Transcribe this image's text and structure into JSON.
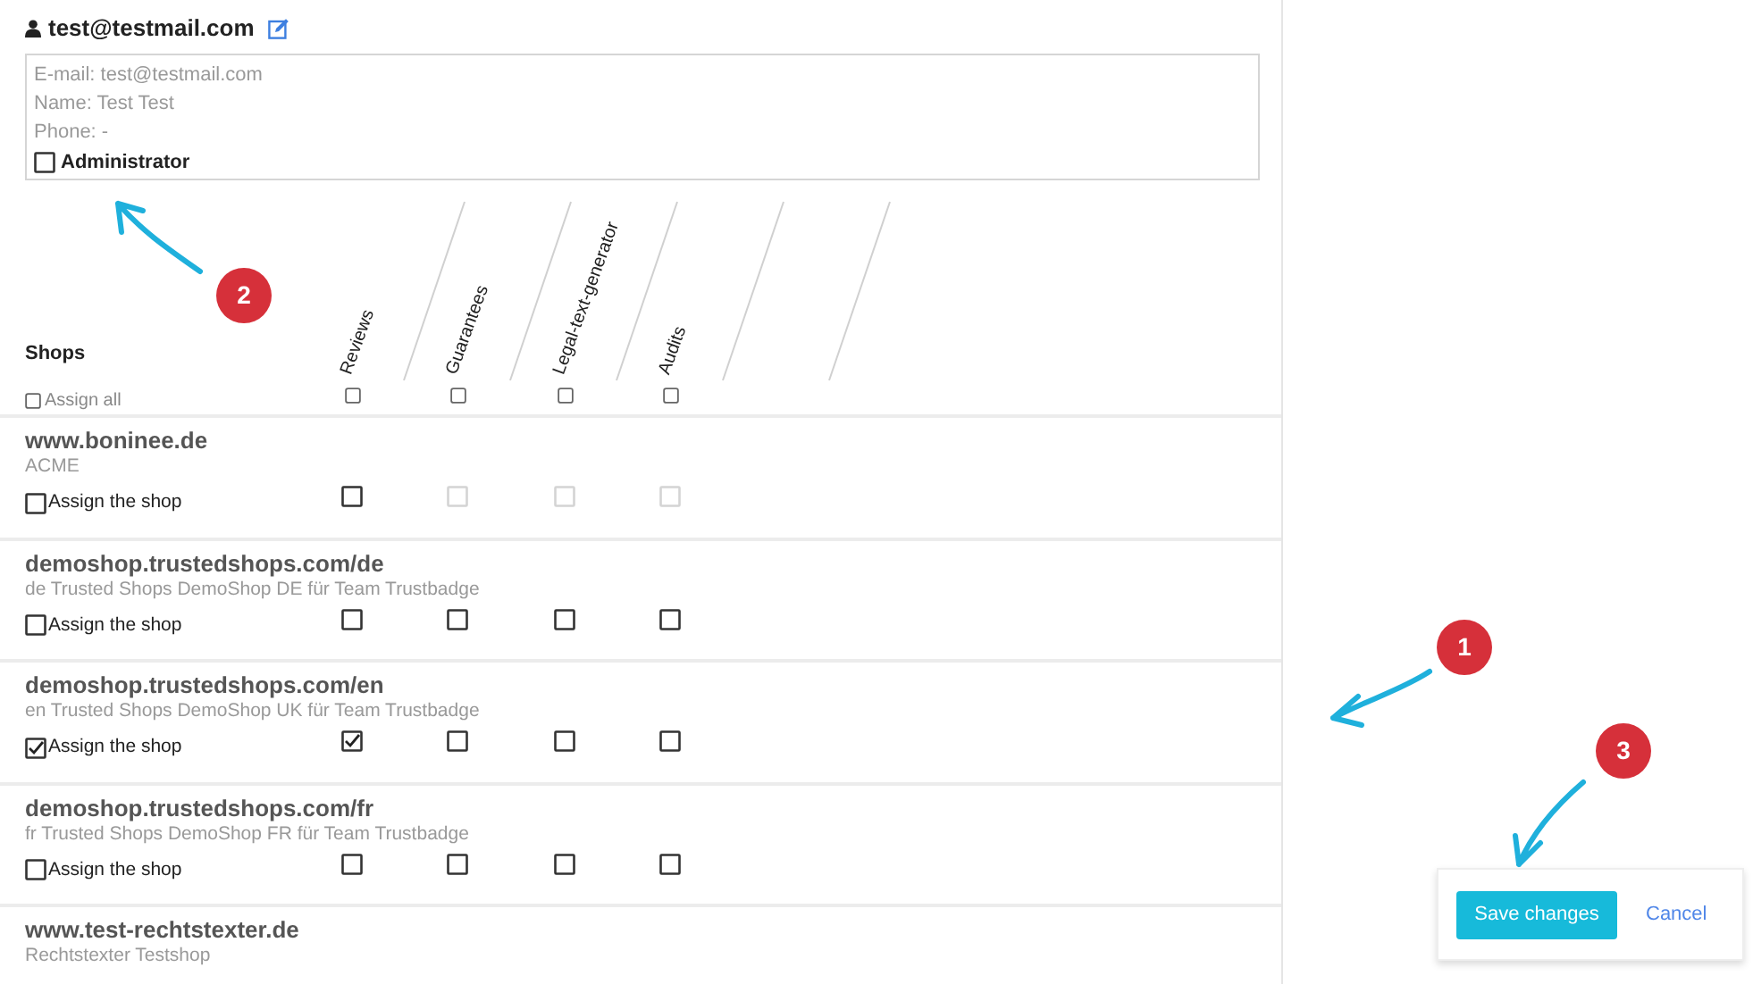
{
  "user": {
    "title": "test@testmail.com",
    "email": "E-mail: test@testmail.com",
    "name": "Name: Test Test",
    "phone": "Phone: -",
    "admin": {
      "label": "Administrator",
      "checked": false
    }
  },
  "shops_heading": "Shops",
  "assign_all": {
    "label": "Assign all",
    "checked": false
  },
  "columns": [
    {
      "label": "Reviews",
      "checked": false
    },
    {
      "label": "Guarantees",
      "checked": false
    },
    {
      "label": "Legal-text-generator",
      "checked": false
    },
    {
      "label": "Audits",
      "checked": false
    }
  ],
  "shops": [
    {
      "url": "www.boninee.de",
      "description": "ACME",
      "assign_label": "Assign the shop",
      "assigned": false,
      "services": [
        {
          "checked": false,
          "disabled": false
        },
        {
          "checked": false,
          "disabled": true
        },
        {
          "checked": false,
          "disabled": true
        },
        {
          "checked": false,
          "disabled": true
        }
      ]
    },
    {
      "url": "demoshop.trustedshops.com/de",
      "description": "de Trusted Shops DemoShop DE für Team Trustbadge",
      "assign_label": "Assign the shop",
      "assigned": false,
      "services": [
        {
          "checked": false,
          "disabled": false
        },
        {
          "checked": false,
          "disabled": false
        },
        {
          "checked": false,
          "disabled": false
        },
        {
          "checked": false,
          "disabled": false
        }
      ]
    },
    {
      "url": "demoshop.trustedshops.com/en",
      "description": "en Trusted Shops DemoShop UK für Team Trustbadge",
      "assign_label": "Assign the shop",
      "assigned": true,
      "services": [
        {
          "checked": true,
          "disabled": false
        },
        {
          "checked": false,
          "disabled": false
        },
        {
          "checked": false,
          "disabled": false
        },
        {
          "checked": false,
          "disabled": false
        }
      ]
    },
    {
      "url": "demoshop.trustedshops.com/fr",
      "description": "fr Trusted Shops DemoShop FR für Team Trustbadge",
      "assign_label": "Assign the shop",
      "assigned": false,
      "services": [
        {
          "checked": false,
          "disabled": false
        },
        {
          "checked": false,
          "disabled": false
        },
        {
          "checked": false,
          "disabled": false
        },
        {
          "checked": false,
          "disabled": false
        }
      ]
    },
    {
      "url": "www.test-rechtstexter.de",
      "description": "Rechtstexter Testshop"
    }
  ],
  "actions": {
    "save": "Save changes",
    "cancel": "Cancel"
  },
  "annotations": [
    {
      "number": "1"
    },
    {
      "number": "2"
    },
    {
      "number": "3"
    }
  ]
}
